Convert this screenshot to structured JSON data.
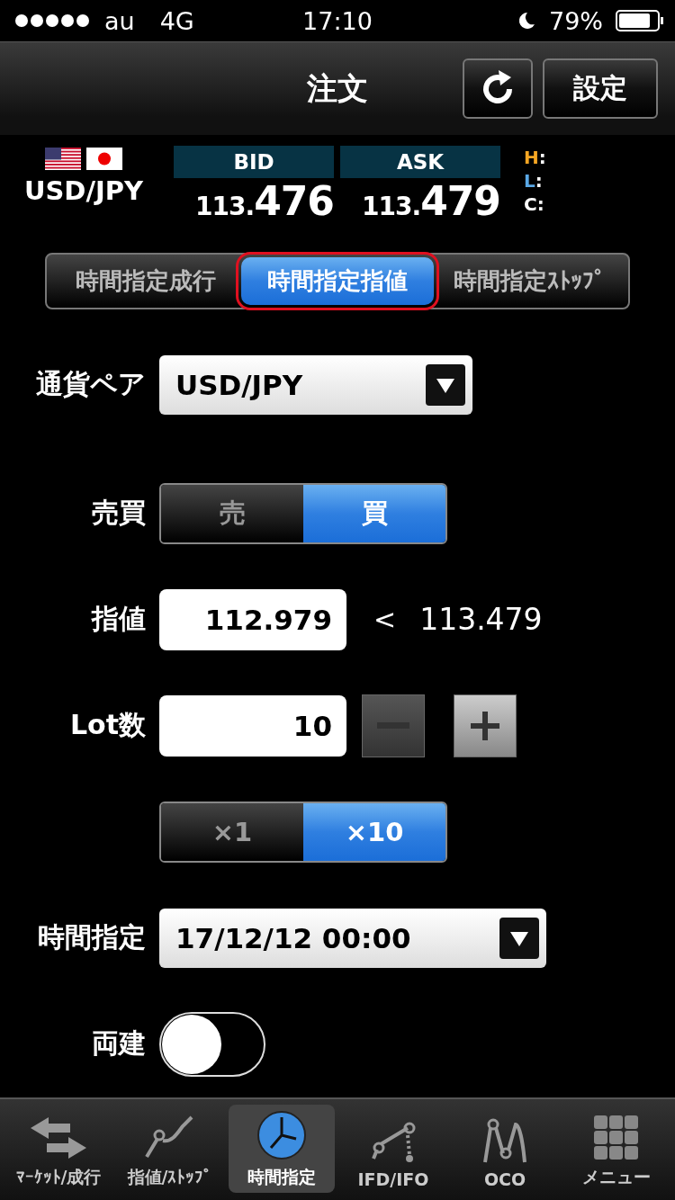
{
  "status_bar": {
    "carrier": "au",
    "network": "4G",
    "time": "17:10",
    "battery": "79%"
  },
  "header": {
    "title": "注文",
    "settings_button": "設定"
  },
  "quote": {
    "pair": "USD/JPY",
    "prices": [
      {
        "label": "BID",
        "prefix": "113.",
        "pips": "476"
      },
      {
        "label": "ASK",
        "prefix": "113.",
        "pips": "479"
      }
    ],
    "stats": [
      {
        "letter": "H",
        "color": "#f5a623",
        "sep": ":"
      },
      {
        "letter": "L",
        "color": "#5aa8e6",
        "sep": ":"
      },
      {
        "letter": "C",
        "color": "#ffffff",
        "sep": ":"
      }
    ]
  },
  "order_tabs": [
    {
      "label": "時間指定成行",
      "selected": false,
      "highlighted": false
    },
    {
      "label": "時間指定指値",
      "selected": true,
      "highlighted": true
    },
    {
      "label": "時間指定ｽﾄｯﾌﾟ",
      "selected": false,
      "highlighted": false
    }
  ],
  "form": [
    {
      "kind": "select",
      "label": "通貨ペア",
      "value": "USD/JPY",
      "wide": false
    },
    {
      "kind": "segment",
      "label": "売買",
      "options": [
        {
          "label": "売",
          "selected": false
        },
        {
          "label": "買",
          "selected": true
        }
      ]
    },
    {
      "kind": "price",
      "label": "指値",
      "value": "112.979",
      "compare": "<",
      "reference": "113.479"
    },
    {
      "kind": "stepper",
      "label": "Lot数",
      "value": "10"
    },
    {
      "kind": "segment",
      "options": [
        {
          "label": "×1",
          "selected": false
        },
        {
          "label": "×10",
          "selected": true
        }
      ]
    },
    {
      "kind": "select",
      "label": "時間指定",
      "value": "17/12/12 00:00",
      "wide": true
    },
    {
      "kind": "toggle",
      "label": "両建",
      "on": false
    }
  ],
  "tab_bar": [
    {
      "label": "ﾏｰｹｯﾄ/成行",
      "kind": "arrows",
      "selected": false
    },
    {
      "label": "指値/ｽﾄｯﾌﾟ",
      "kind": "curve",
      "selected": false
    },
    {
      "label": "時間指定",
      "kind": "clock",
      "selected": true
    },
    {
      "label": "IFD/IFO",
      "kind": "ifd",
      "selected": false
    },
    {
      "label": "OCO",
      "kind": "oco",
      "selected": false
    },
    {
      "label": "メニュー",
      "kind": "grid",
      "selected": false
    }
  ]
}
